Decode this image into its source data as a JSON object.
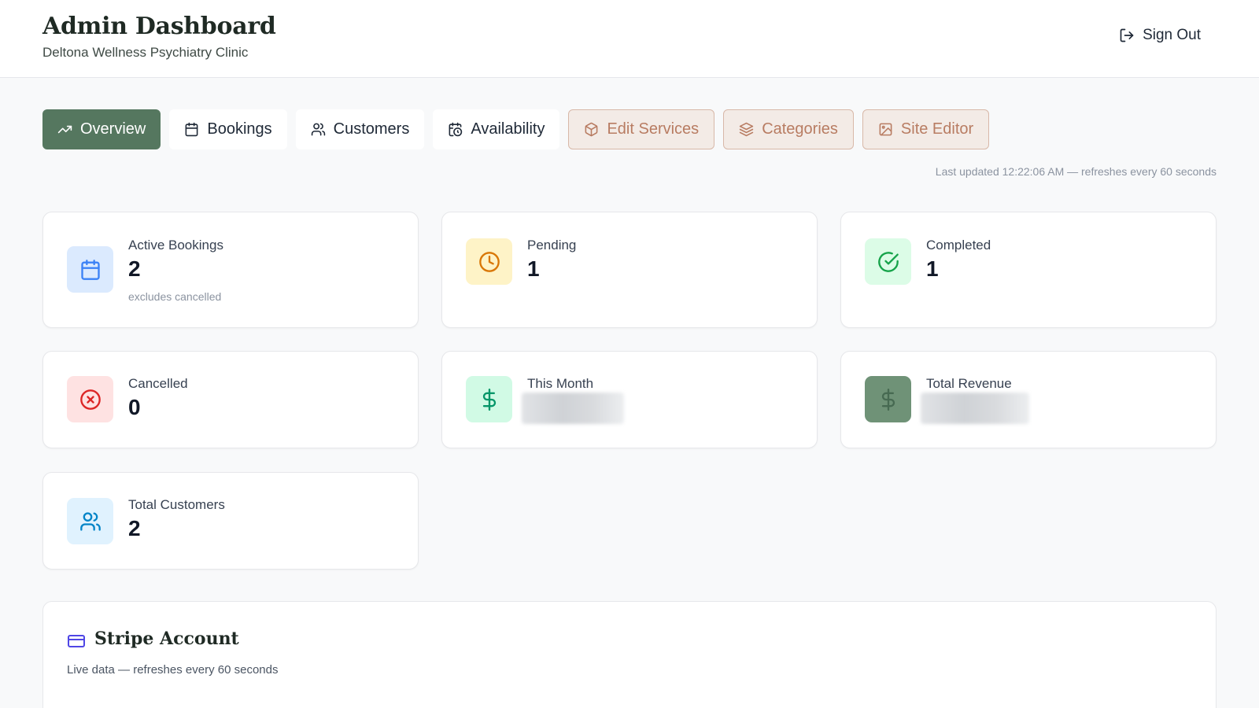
{
  "header": {
    "title": "Admin Dashboard",
    "subtitle": "Deltona Wellness Psychiatry Clinic",
    "sign_out": "Sign Out"
  },
  "tabs": [
    {
      "label": "Overview",
      "icon": "trending-up-icon",
      "state": "active"
    },
    {
      "label": "Bookings",
      "icon": "calendar-icon",
      "state": "plain"
    },
    {
      "label": "Customers",
      "icon": "users-icon",
      "state": "plain"
    },
    {
      "label": "Availability",
      "icon": "calendar-clock-icon",
      "state": "plain"
    },
    {
      "label": "Edit Services",
      "icon": "package-icon",
      "state": "warm"
    },
    {
      "label": "Categories",
      "icon": "layers-icon",
      "state": "warm"
    },
    {
      "label": "Site Editor",
      "icon": "image-icon",
      "state": "warm"
    }
  ],
  "last_updated": "Last updated 12:22:06 AM — refreshes every 60 seconds",
  "stats": {
    "active_bookings": {
      "label": "Active Bookings",
      "value": "2",
      "note": "excludes cancelled",
      "icon": "calendar-icon",
      "color": "#3b82f6",
      "bg": "#dbeafe"
    },
    "pending": {
      "label": "Pending",
      "value": "1",
      "icon": "clock-icon",
      "color": "#d97706",
      "bg": "#fef3c7"
    },
    "completed": {
      "label": "Completed",
      "value": "1",
      "icon": "check-circle-icon",
      "color": "#16a34a",
      "bg": "#dcfce7"
    },
    "cancelled": {
      "label": "Cancelled",
      "value": "0",
      "icon": "x-circle-icon",
      "color": "#dc2626",
      "bg": "#fee2e2"
    },
    "this_month": {
      "label": "This Month",
      "icon": "dollar-icon",
      "color": "#059669",
      "bg": "#d1fae5"
    },
    "total_revenue": {
      "label": "Total Revenue",
      "icon": "dollar-icon",
      "color": "#476a52",
      "bg": "#6f9277"
    },
    "total_customers": {
      "label": "Total Customers",
      "value": "2",
      "icon": "users-icon",
      "color": "#0284c7",
      "bg": "#e0f2fe"
    }
  },
  "stripe": {
    "title": "Stripe Account",
    "subtitle": "Live data — refreshes every 60 seconds",
    "icon": "credit-card-icon",
    "color": "#4f46e5"
  }
}
